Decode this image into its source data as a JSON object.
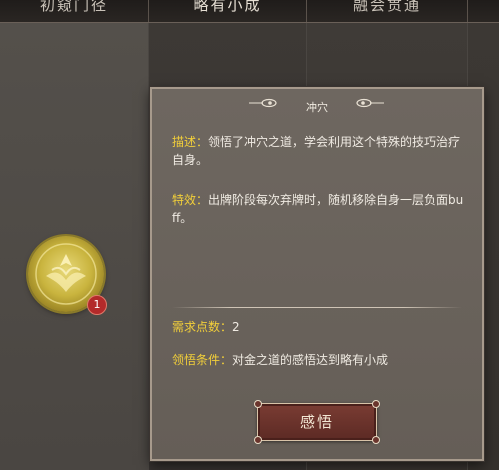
{
  "tabs": [
    {
      "label": "初窥门径"
    },
    {
      "label": "略有小成"
    },
    {
      "label": "融会贯通"
    }
  ],
  "skill": {
    "icon": "golden-seal-icon",
    "badge_count": "1"
  },
  "popup": {
    "title": "冲穴",
    "desc_label": "描述：",
    "desc_text": "领悟了冲穴之道，学会利用这个特殊的技巧治疗自身。",
    "effect_label": "特效：",
    "effect_text": "出牌阶段每次弃牌时，随机移除自身一层负面buff。",
    "points_label": "需求点数：",
    "points_value": "2",
    "cond_label": "领悟条件：",
    "cond_text": "对金之道的感悟达到略有小成",
    "button_label": "感悟"
  },
  "colors": {
    "accent_label": "#f2cf3a",
    "button": "#6a332b",
    "badge": "#b32a2a"
  }
}
